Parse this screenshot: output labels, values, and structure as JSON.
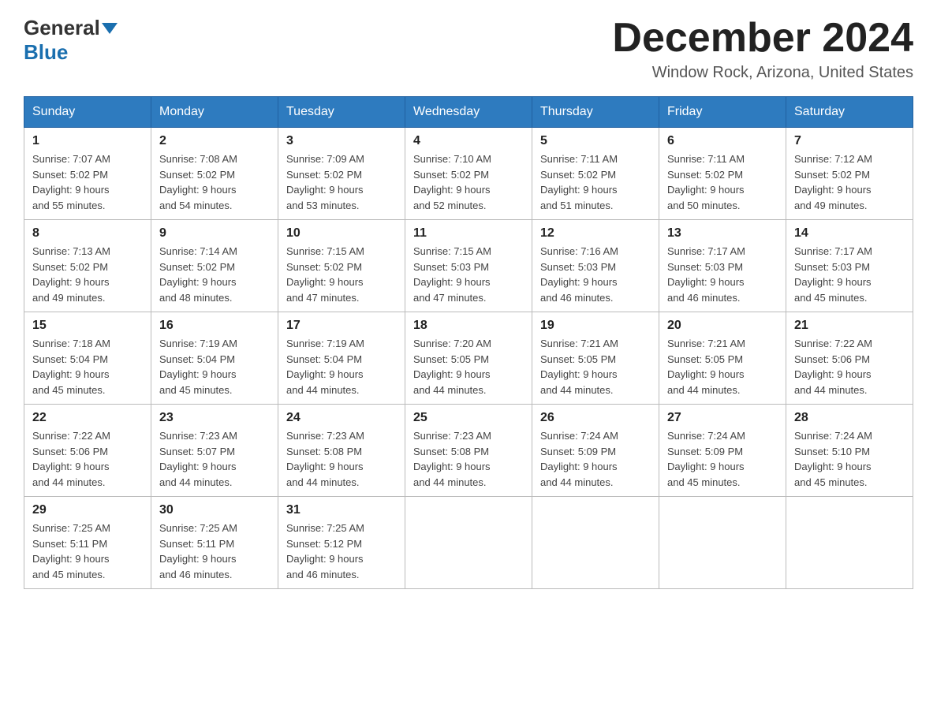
{
  "header": {
    "logo_line1": "General",
    "logo_line2": "Blue",
    "month_title": "December 2024",
    "location": "Window Rock, Arizona, United States"
  },
  "days_of_week": [
    "Sunday",
    "Monday",
    "Tuesday",
    "Wednesday",
    "Thursday",
    "Friday",
    "Saturday"
  ],
  "weeks": [
    [
      {
        "day": "1",
        "sunrise": "7:07 AM",
        "sunset": "5:02 PM",
        "daylight": "9 hours and 55 minutes."
      },
      {
        "day": "2",
        "sunrise": "7:08 AM",
        "sunset": "5:02 PM",
        "daylight": "9 hours and 54 minutes."
      },
      {
        "day": "3",
        "sunrise": "7:09 AM",
        "sunset": "5:02 PM",
        "daylight": "9 hours and 53 minutes."
      },
      {
        "day": "4",
        "sunrise": "7:10 AM",
        "sunset": "5:02 PM",
        "daylight": "9 hours and 52 minutes."
      },
      {
        "day": "5",
        "sunrise": "7:11 AM",
        "sunset": "5:02 PM",
        "daylight": "9 hours and 51 minutes."
      },
      {
        "day": "6",
        "sunrise": "7:11 AM",
        "sunset": "5:02 PM",
        "daylight": "9 hours and 50 minutes."
      },
      {
        "day": "7",
        "sunrise": "7:12 AM",
        "sunset": "5:02 PM",
        "daylight": "9 hours and 49 minutes."
      }
    ],
    [
      {
        "day": "8",
        "sunrise": "7:13 AM",
        "sunset": "5:02 PM",
        "daylight": "9 hours and 49 minutes."
      },
      {
        "day": "9",
        "sunrise": "7:14 AM",
        "sunset": "5:02 PM",
        "daylight": "9 hours and 48 minutes."
      },
      {
        "day": "10",
        "sunrise": "7:15 AM",
        "sunset": "5:02 PM",
        "daylight": "9 hours and 47 minutes."
      },
      {
        "day": "11",
        "sunrise": "7:15 AM",
        "sunset": "5:03 PM",
        "daylight": "9 hours and 47 minutes."
      },
      {
        "day": "12",
        "sunrise": "7:16 AM",
        "sunset": "5:03 PM",
        "daylight": "9 hours and 46 minutes."
      },
      {
        "day": "13",
        "sunrise": "7:17 AM",
        "sunset": "5:03 PM",
        "daylight": "9 hours and 46 minutes."
      },
      {
        "day": "14",
        "sunrise": "7:17 AM",
        "sunset": "5:03 PM",
        "daylight": "9 hours and 45 minutes."
      }
    ],
    [
      {
        "day": "15",
        "sunrise": "7:18 AM",
        "sunset": "5:04 PM",
        "daylight": "9 hours and 45 minutes."
      },
      {
        "day": "16",
        "sunrise": "7:19 AM",
        "sunset": "5:04 PM",
        "daylight": "9 hours and 45 minutes."
      },
      {
        "day": "17",
        "sunrise": "7:19 AM",
        "sunset": "5:04 PM",
        "daylight": "9 hours and 44 minutes."
      },
      {
        "day": "18",
        "sunrise": "7:20 AM",
        "sunset": "5:05 PM",
        "daylight": "9 hours and 44 minutes."
      },
      {
        "day": "19",
        "sunrise": "7:21 AM",
        "sunset": "5:05 PM",
        "daylight": "9 hours and 44 minutes."
      },
      {
        "day": "20",
        "sunrise": "7:21 AM",
        "sunset": "5:05 PM",
        "daylight": "9 hours and 44 minutes."
      },
      {
        "day": "21",
        "sunrise": "7:22 AM",
        "sunset": "5:06 PM",
        "daylight": "9 hours and 44 minutes."
      }
    ],
    [
      {
        "day": "22",
        "sunrise": "7:22 AM",
        "sunset": "5:06 PM",
        "daylight": "9 hours and 44 minutes."
      },
      {
        "day": "23",
        "sunrise": "7:23 AM",
        "sunset": "5:07 PM",
        "daylight": "9 hours and 44 minutes."
      },
      {
        "day": "24",
        "sunrise": "7:23 AM",
        "sunset": "5:08 PM",
        "daylight": "9 hours and 44 minutes."
      },
      {
        "day": "25",
        "sunrise": "7:23 AM",
        "sunset": "5:08 PM",
        "daylight": "9 hours and 44 minutes."
      },
      {
        "day": "26",
        "sunrise": "7:24 AM",
        "sunset": "5:09 PM",
        "daylight": "9 hours and 44 minutes."
      },
      {
        "day": "27",
        "sunrise": "7:24 AM",
        "sunset": "5:09 PM",
        "daylight": "9 hours and 45 minutes."
      },
      {
        "day": "28",
        "sunrise": "7:24 AM",
        "sunset": "5:10 PM",
        "daylight": "9 hours and 45 minutes."
      }
    ],
    [
      {
        "day": "29",
        "sunrise": "7:25 AM",
        "sunset": "5:11 PM",
        "daylight": "9 hours and 45 minutes."
      },
      {
        "day": "30",
        "sunrise": "7:25 AM",
        "sunset": "5:11 PM",
        "daylight": "9 hours and 46 minutes."
      },
      {
        "day": "31",
        "sunrise": "7:25 AM",
        "sunset": "5:12 PM",
        "daylight": "9 hours and 46 minutes."
      },
      null,
      null,
      null,
      null
    ]
  ],
  "labels": {
    "sunrise": "Sunrise: ",
    "sunset": "Sunset: ",
    "daylight": "Daylight: "
  }
}
